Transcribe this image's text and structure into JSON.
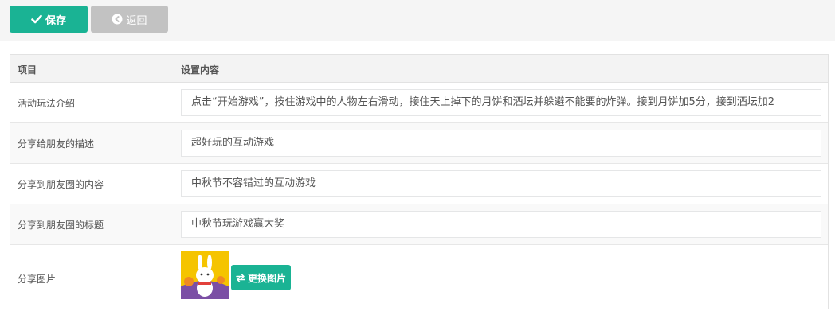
{
  "toolbar": {
    "save_label": "保存",
    "back_label": "返回"
  },
  "table": {
    "headers": [
      "项目",
      "设置内容"
    ],
    "rows": [
      {
        "label": "活动玩法介绍",
        "value": "点击“开始游戏”，按住游戏中的人物左右滑动，接住天上掉下的月饼和酒坛并躲避不能要的炸弹。接到月饼加5分，接到酒坛加2"
      },
      {
        "label": "分享给朋友的描述",
        "value": "超好玩的互动游戏"
      },
      {
        "label": "分享到朋友圈的内容",
        "value": "中秋节不容错过的互动游戏"
      },
      {
        "label": "分享到朋友圈的标题",
        "value": "中秋节玩游戏赢大奖"
      }
    ],
    "image_row": {
      "label": "分享图片",
      "change_button": "更换图片"
    }
  },
  "colors": {
    "primary": "#1ab394",
    "disabled": "#c2c2c2"
  },
  "icons": {
    "save": "check-icon",
    "back": "arrow-left-circle-icon",
    "change": "exchange-icon"
  }
}
